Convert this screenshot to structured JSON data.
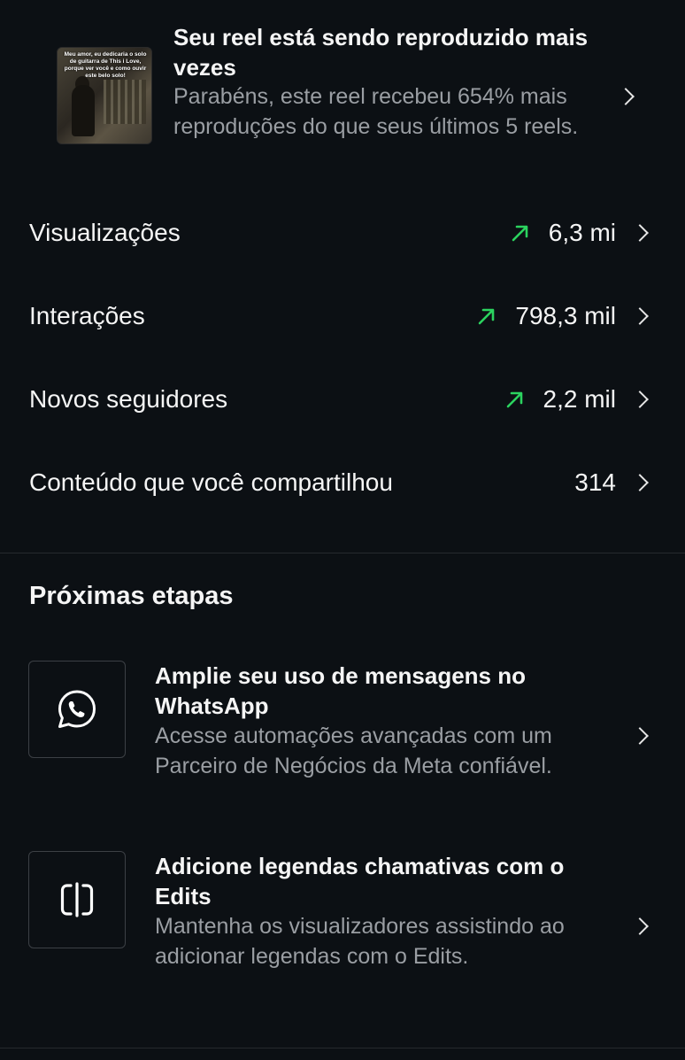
{
  "reel_card": {
    "thumbnail_caption": "Meu amor, eu dedicaria o solo de guitarra de This i Love, porque ver você e como ouvir este belo solo!",
    "title": "Seu reel está sendo reproduzido mais vezes",
    "description": "Parabéns, este reel recebeu 654% mais reproduções do que seus últimos 5 reels."
  },
  "metrics": [
    {
      "label": "Visualizações",
      "value": "6,3 mi",
      "trend": "up"
    },
    {
      "label": "Interações",
      "value": "798,3 mil",
      "trend": "up"
    },
    {
      "label": "Novos seguidores",
      "value": "2,2 mil",
      "trend": "up"
    },
    {
      "label": "Conteúdo que você compartilhou",
      "value": "314",
      "trend": "none"
    }
  ],
  "next_steps": {
    "title": "Próximas etapas",
    "items": [
      {
        "icon": "whatsapp-icon",
        "title": "Amplie seu uso de mensagens no WhatsApp",
        "description": "Acesse automações avançadas com um Parceiro de Negócios da Meta confiável."
      },
      {
        "icon": "edits-icon",
        "title": "Adicione legendas chamativas com o Edits",
        "description": "Mantenha os visualizadores assistindo ao adicionar legendas com o Edits."
      }
    ]
  },
  "colors": {
    "background": "#0c1014",
    "primary_text": "#f5f5f5",
    "secondary_text": "#9a9ea3",
    "trend_up": "#2bd35f",
    "divider": "#262a2e"
  }
}
